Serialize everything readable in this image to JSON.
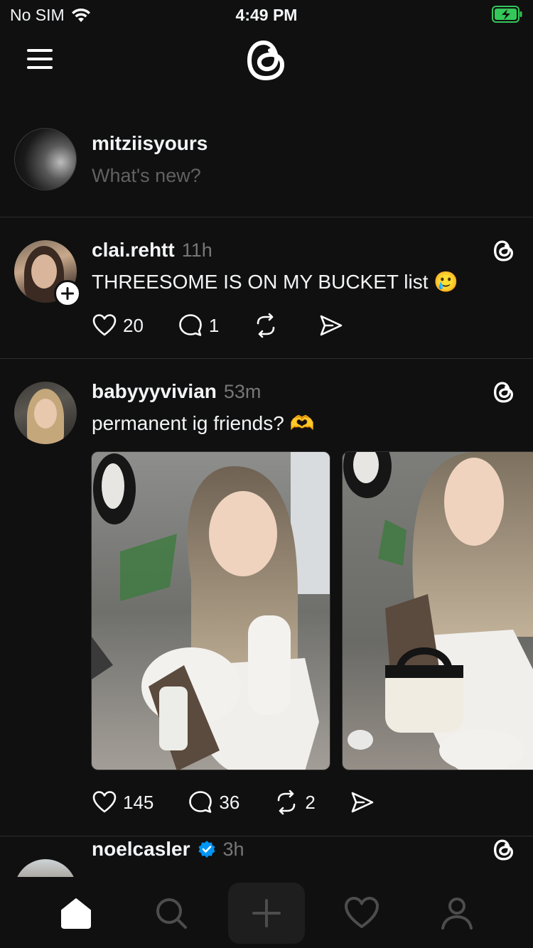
{
  "status_bar": {
    "carrier": "No SIM",
    "time": "4:49 PM"
  },
  "composer": {
    "username": "mitziisyours",
    "placeholder": "What's new?"
  },
  "posts": [
    {
      "username": "clai.rehtt",
      "time": "11h",
      "text": "THREESOME IS ON MY BUCKET list 🥲",
      "likes": "20",
      "comments": "1",
      "reposts": "",
      "has_follow_badge": true
    },
    {
      "username": "babyyyvivian",
      "time": "53m",
      "text": "permanent ig friends? 🫶",
      "likes": "145",
      "comments": "36",
      "reposts": "2"
    },
    {
      "username": "noelcasler",
      "time": "3h",
      "verified": true
    }
  ],
  "icons": {
    "menu": "menu-icon",
    "logo": "threads-logo-icon",
    "like": "heart-icon",
    "comment": "comment-icon",
    "repost": "repost-icon",
    "share": "send-icon"
  },
  "tabs": [
    "home",
    "search",
    "create",
    "activity",
    "profile"
  ],
  "colors": {
    "background": "#101010",
    "text": "#f3f5f7",
    "muted": "#777777",
    "verified": "#0095f6",
    "battery": "#34c759"
  }
}
